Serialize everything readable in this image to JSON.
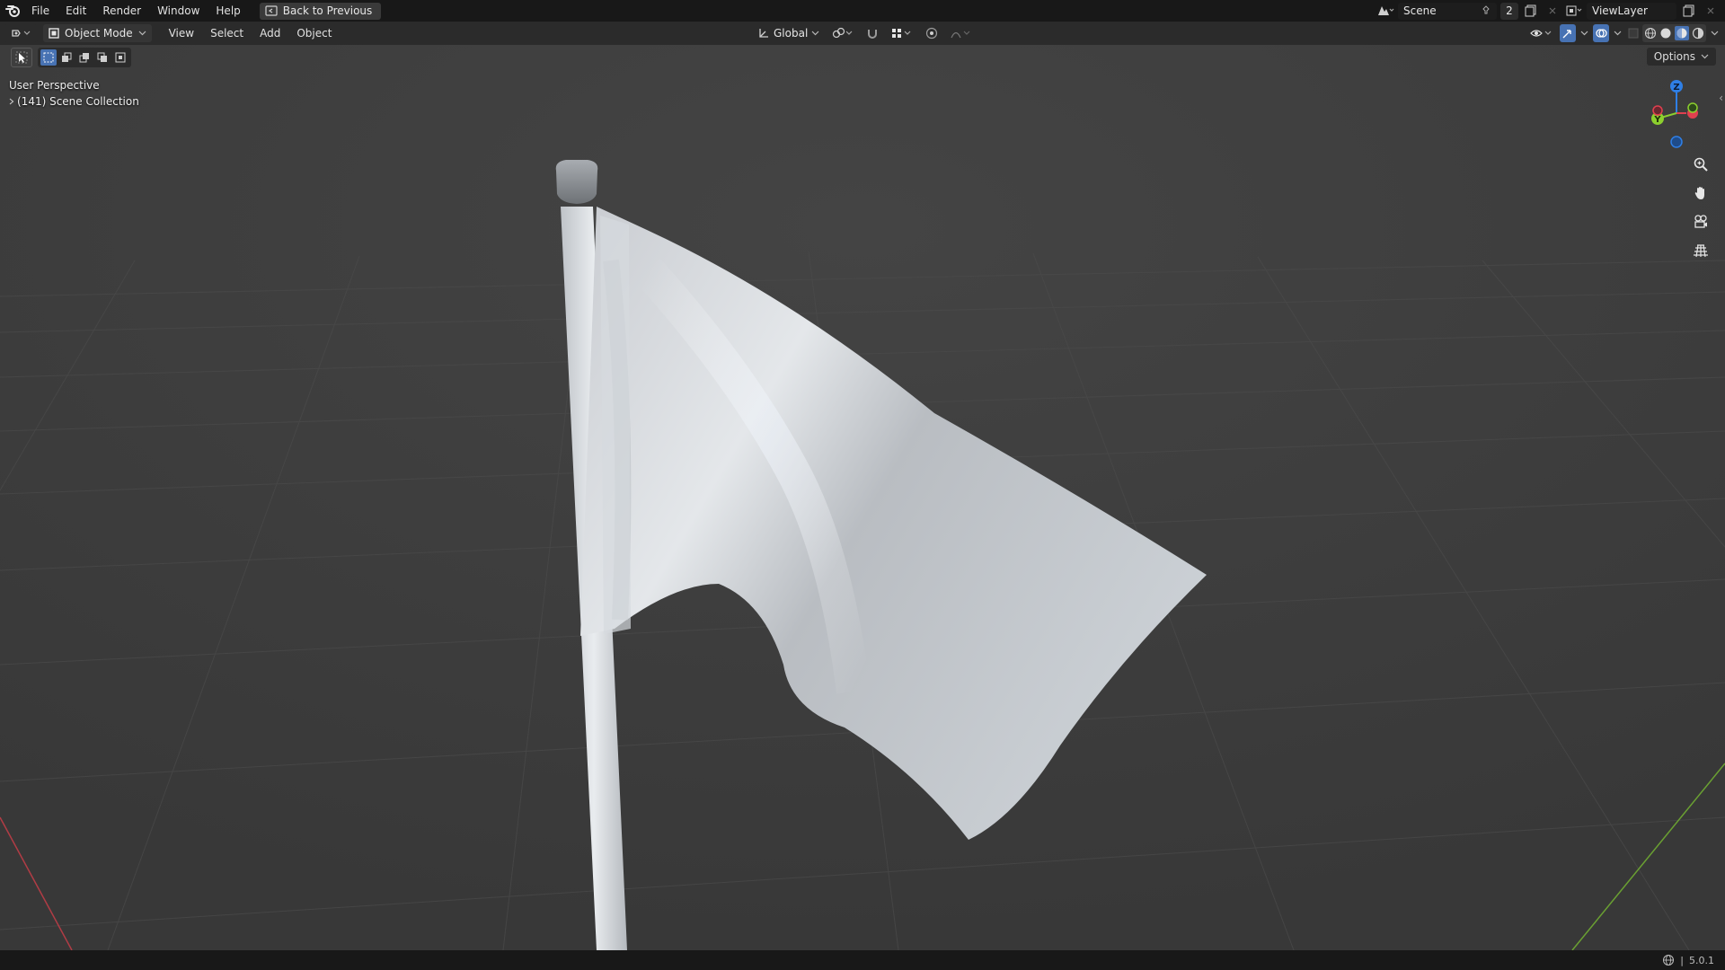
{
  "topbar": {
    "menus": [
      "File",
      "Edit",
      "Render",
      "Window",
      "Help"
    ],
    "back_button": "Back to Previous",
    "scene_name": "Scene",
    "scene_users": "2",
    "view_layer": "ViewLayer"
  },
  "header": {
    "mode": "Object Mode",
    "menus": [
      "View",
      "Select",
      "Add",
      "Object"
    ],
    "transform_orientation": "Global"
  },
  "toolbar": {
    "options_label": "Options"
  },
  "viewport": {
    "perspective_label": "User Perspective",
    "collection_label": "(141) Scene Collection"
  },
  "gizmo": {
    "z": "Z",
    "y": "Y"
  },
  "status": {
    "version": "5.0.1"
  },
  "colors": {
    "accent": "#4772b3",
    "axis_x": "#e0404f",
    "axis_y": "#8ccf2e",
    "axis_z": "#2f7fe6"
  }
}
